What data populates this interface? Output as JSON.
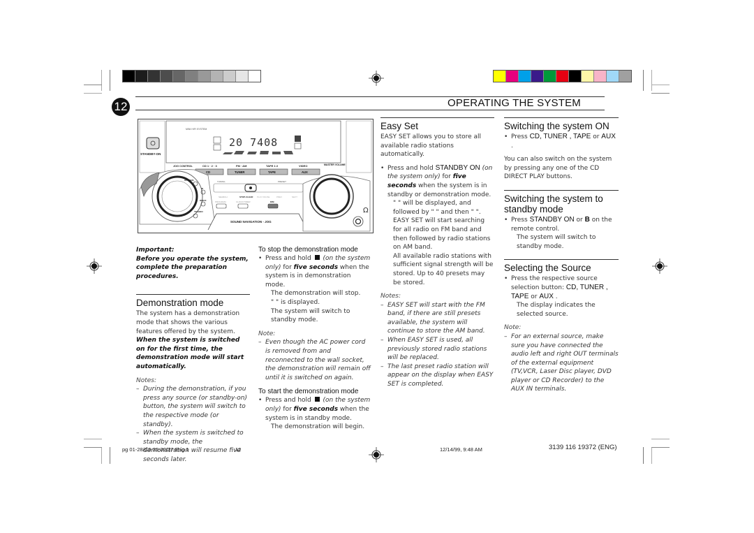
{
  "header": {
    "page_number": "12",
    "title": "OPERATING THE SYSTEM"
  },
  "print_marks": {
    "gray_swatches": [
      "#000000",
      "#1c1c1c",
      "#333333",
      "#4d4d4d",
      "#666666",
      "#808080",
      "#999999",
      "#b3b3b3",
      "#cccccc",
      "#e6e6e6",
      "#ffffff"
    ],
    "color_swatches": [
      "#ffff00",
      "#e6007e",
      "#00a0e9",
      "#3a1a8a",
      "#00993a",
      "#e60012",
      "#000000",
      "#fff7a8",
      "#f7b4c8",
      "#a0d8f7",
      "#a0a0a0"
    ]
  },
  "illustration": {
    "brand_label": "MINI HIFI SYSTEM",
    "standby_label": "STANDBY-ON",
    "display_readout": "20  7408",
    "jog_control_label": "JOG CONTROL",
    "source_labels_top": [
      "CD 1 · 2 · 3",
      "FM · AM",
      "TAPE 1·2",
      "VIDEO"
    ],
    "source_buttons": [
      "CD",
      "TUNER",
      "TAPE",
      "AUX"
    ],
    "master_volume_label": "MASTER VOLUME",
    "transport_labels": [
      "SEARCH",
      "STOP·CLEAR",
      "PLAY·PAUSE",
      "PREV",
      "NEXT"
    ],
    "tuning_label": "TUNING",
    "preset_label": "PRESET",
    "small_buttons": [
      "PROGRAM",
      "CLOCK/TIMER",
      "DIM"
    ],
    "jog_side_labels": [
      "OPTIONS",
      "IR",
      "WOOX",
      "TECHNO"
    ],
    "sound_nav_label": "SOUND NAVIGATION - JOG"
  },
  "col1": {
    "important_label": "Important:",
    "important_text": "Before you operate the system, complete the preparation procedures.",
    "demo_heading": "Demonstration mode",
    "demo_text_a": "The system has a demonstration mode that shows the various features offered by the system. ",
    "demo_text_b": "When the system is switched on for the first time, the demonstration mode will start automatically.",
    "notes_label": "Notes:",
    "notes": [
      "During the demonstration, if you press any source (or standby-on) button, the system will switch to the respective mode (or standby).",
      "When the system is switched to standby mode, the demonstration will resume five seconds later."
    ]
  },
  "col2": {
    "stop_heading": "To stop the demonstration mode",
    "stop_press": "Press and hold ",
    "stop_on_system": "(on the system only)",
    "stop_for": " for ",
    "five_seconds": "five seconds",
    "stop_when": " when the system is in demonstration mode.",
    "stop_result1": "The demonstration will stop.",
    "stop_result2": "\"              \" is displayed.",
    "stop_result3": "The system will switch to standby mode.",
    "note_label": "Note:",
    "note": "Even though the AC power cord is removed from and reconnected to the wall socket, the demonstration will remain off until it is switched on again.",
    "start_heading": "To start the demonstration mode",
    "start_press": "Press and hold ",
    "start_on_system": "(on the system only)",
    "start_for": " for ",
    "start_when": " when the system is in standby mode.",
    "start_result": "The demonstration will begin."
  },
  "col3": {
    "heading": "Easy Set",
    "intro": "EASY SET allows you to store all available radio stations automatically.",
    "press": "Press and hold ",
    "standby_on": "STANDBY ON",
    "on_system": " (on the system only)",
    "for": " for ",
    "five_seconds": "five seconds",
    "when": " when the system is in standby or demonstration mode.",
    "result1": "\"              \" will be displayed, and followed by \"          \" and then \"       \".",
    "result2": "EASY SET will start searching for all radio on FM band and then followed by radio stations on AM band.",
    "result3": "All available radio stations with sufficient signal strength will be stored. Up to 40 presets may be stored.",
    "notes_label": "Notes:",
    "notes": [
      "EASY SET will start with the FM band, if there are still presets available, the system will continue to store the AM band.",
      "When EASY SET is used, all previously stored radio stations will be replaced.",
      "The last preset radio station will appear on the display when EASY SET is completed."
    ]
  },
  "col4": {
    "on_heading": "Switching the system ON",
    "on_press": "Press ",
    "on_buttons": "CD, TUNER , TAPE",
    "on_or": " or ",
    "on_aux": "AUX",
    "on_end": " .",
    "on_text": "You can also switch on the system by pressing any one of the CD DIRECT PLAY buttons.",
    "standby_heading": "Switching the system to standby mode",
    "standby_press": "Press ",
    "standby_button": "STANDBY ON",
    "standby_or": "  or ",
    "standby_b": "B",
    "standby_end": "  on the remote control.",
    "standby_result": "The system will switch to standby mode.",
    "source_heading": "Selecting the Source",
    "source_press": "Press the respective source selection button: ",
    "source_buttons": "CD, TUNER , TAPE",
    "source_or": " or ",
    "source_aux": "AUX",
    "source_end": " .",
    "source_result": "The display indicates the selected source.",
    "note_label": "Note:",
    "note": "For an external source, make sure you have connected the audio left and right OUT terminals of the external equipment (TV,VCR, Laser Disc player, DVD player or CD Recorder) to the AUX IN terminals."
  },
  "footer": {
    "file_name": "pg 01-28/C3-35-30/37-Eng 1",
    "page": "12",
    "timestamp": "12/14/99, 9:48 AM",
    "doc_code": "3139 116 19372 (ENG)"
  }
}
